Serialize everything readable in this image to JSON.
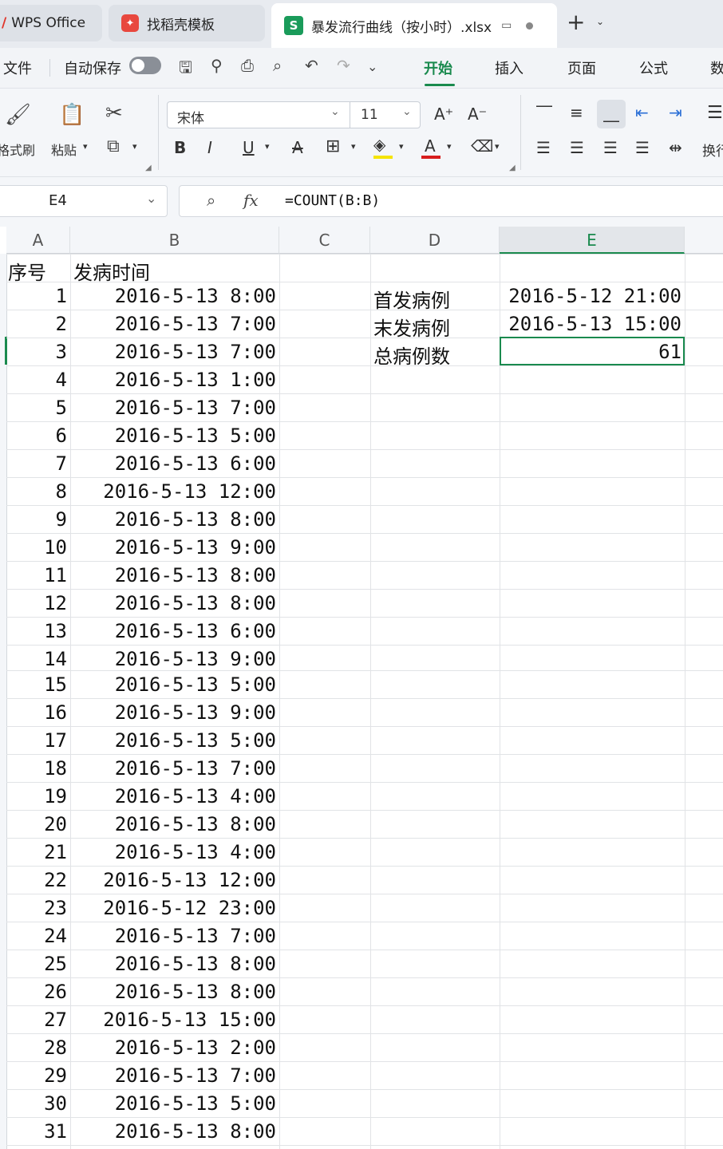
{
  "tabs": {
    "wps": "WPS Office",
    "docer": "找稻壳模板",
    "active_file": "暴发流行曲线（按小时）.xlsx",
    "active_icon": "S"
  },
  "menu": {
    "file": "文件",
    "autosave": "自动保存",
    "tabs": [
      "开始",
      "插入",
      "页面",
      "公式",
      "数"
    ]
  },
  "ribbon": {
    "format_painter": "格式刷",
    "paste": "粘贴",
    "font_name": "宋体",
    "font_size": "11",
    "wrap": "换行"
  },
  "formula_bar": {
    "name_box": "E4",
    "fx": "fx",
    "formula": "=COUNT(B:B)"
  },
  "columns": [
    "A",
    "B",
    "C",
    "D",
    "E"
  ],
  "selected_column": "E",
  "headers": {
    "a": "序号",
    "b": "发病时间"
  },
  "rows": [
    {
      "n": "1",
      "t": "2016-5-13  8:00"
    },
    {
      "n": "2",
      "t": "2016-5-13  7:00"
    },
    {
      "n": "3",
      "t": "2016-5-13  7:00"
    },
    {
      "n": "4",
      "t": "2016-5-13  1:00"
    },
    {
      "n": "5",
      "t": "2016-5-13  7:00"
    },
    {
      "n": "6",
      "t": "2016-5-13  5:00"
    },
    {
      "n": "7",
      "t": "2016-5-13  6:00"
    },
    {
      "n": "8",
      "t": "2016-5-13 12:00"
    },
    {
      "n": "9",
      "t": "2016-5-13  8:00"
    },
    {
      "n": "10",
      "t": "2016-5-13  9:00"
    },
    {
      "n": "11",
      "t": "2016-5-13  8:00"
    },
    {
      "n": "12",
      "t": "2016-5-13  8:00"
    },
    {
      "n": "13",
      "t": "2016-5-13  6:00"
    },
    {
      "n": "14",
      "t": "2016-5-13 9:00"
    },
    {
      "n": "15",
      "t": "2016-5-13  5:00"
    },
    {
      "n": "16",
      "t": "2016-5-13  9:00"
    },
    {
      "n": "17",
      "t": "2016-5-13  5:00"
    },
    {
      "n": "18",
      "t": "2016-5-13  7:00"
    },
    {
      "n": "19",
      "t": "2016-5-13  4:00"
    },
    {
      "n": "20",
      "t": "2016-5-13  8:00"
    },
    {
      "n": "21",
      "t": "2016-5-13  4:00"
    },
    {
      "n": "22",
      "t": "2016-5-13 12:00"
    },
    {
      "n": "23",
      "t": "2016-5-12 23:00"
    },
    {
      "n": "24",
      "t": "2016-5-13  7:00"
    },
    {
      "n": "25",
      "t": "2016-5-13  8:00"
    },
    {
      "n": "26",
      "t": "2016-5-13  8:00"
    },
    {
      "n": "27",
      "t": "2016-5-13 15:00"
    },
    {
      "n": "28",
      "t": "2016-5-13  2:00"
    },
    {
      "n": "29",
      "t": "2016-5-13  7:00"
    },
    {
      "n": "30",
      "t": "2016-5-13  5:00"
    },
    {
      "n": "31",
      "t": "2016-5-13  8:00"
    }
  ],
  "summary": [
    {
      "label": "首发病例",
      "value": "2016-5-12 21:00"
    },
    {
      "label": "末发病例",
      "value": "2016-5-13 15:00"
    },
    {
      "label": "总病例数",
      "value": "61"
    }
  ],
  "colors": {
    "accent": "#1a8a4e",
    "sheet_icon": "#1a9b5a"
  }
}
